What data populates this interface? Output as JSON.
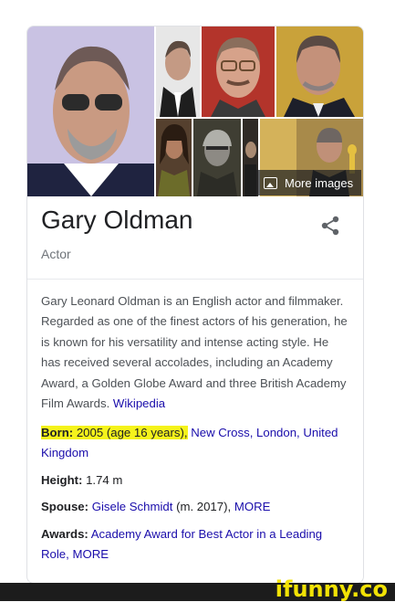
{
  "gallery": {
    "more_images_label": "More images"
  },
  "entity": {
    "name": "Gary Oldman",
    "type": "Actor"
  },
  "description": {
    "text": "Gary Leonard Oldman is an English actor and filmmaker. Regarded as one of the finest actors of his generation, he is known for his versatility and intense acting style. He has received several accolades, including an Academy Award, a Golden Globe Award and three British Academy Film Awards.",
    "source_link": "Wikipedia"
  },
  "facts": {
    "born": {
      "label": "Born:",
      "highlighted_value": "2005 (age 16 years),",
      "place_link": "New Cross, London, United Kingdom"
    },
    "height": {
      "label": "Height:",
      "value": "1.74 m"
    },
    "spouse": {
      "label": "Spouse:",
      "link": "Gisele Schmidt",
      "detail": "(m. 2017),",
      "more": "MORE"
    },
    "awards": {
      "label": "Awards:",
      "link": "Academy Award for Best Actor in a Leading Role,",
      "more": "MORE"
    }
  },
  "watermark": {
    "brand": "ifunny.co"
  },
  "colors": {
    "link": "#1a0dab",
    "highlight": "#f5f31b",
    "title": "#202124",
    "muted": "#70757a"
  }
}
